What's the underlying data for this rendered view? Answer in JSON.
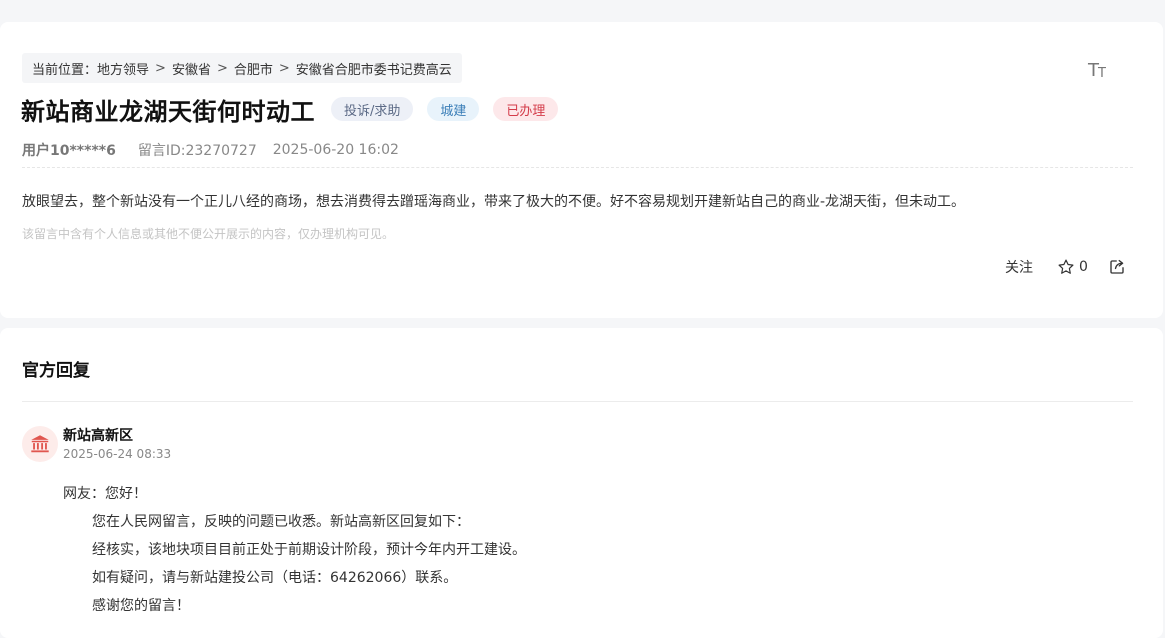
{
  "breadcrumb": {
    "prefix": "当前位置：",
    "items": [
      "地方领导",
      "安徽省",
      "合肥市",
      "安徽省合肥市委书记费高云"
    ],
    "separator": ">"
  },
  "font_size_toggle": {
    "big": "T",
    "small": "T"
  },
  "message": {
    "title": "新站商业龙湖天街何时动工",
    "tags": {
      "type": "投诉/求助",
      "category": "城建",
      "status": "已办理"
    },
    "user": "用户10*****6",
    "message_id": "留言ID:23270727",
    "datetime": "2025-06-20 16:02",
    "content": "放眼望去，整个新站没有一个正儿八经的商场，想去消费得去蹭瑶海商业，带来了极大的不便。好不容易规划开建新站自己的商业-龙湖天街，但未动工。",
    "privacy_note": "该留言中含有个人信息或其他不便公开展示的内容，仅办理机构可见。"
  },
  "actions": {
    "follow_label": "关注",
    "star_count": "0"
  },
  "reply": {
    "heading": "官方回复",
    "org_name": "新站高新区",
    "time": "2025-06-24 08:33",
    "greeting": "网友：您好！",
    "lines": [
      "您在人民网留言，反映的问题已收悉。新站高新区回复如下：",
      "经核实，该地块项目目前正处于前期设计阶段，预计今年内开工建设。",
      "如有疑问，请与新站建投公司（电话：64262066）联系。",
      "感谢您的留言！"
    ]
  },
  "colors": {
    "status_red": "#d43c4a",
    "category_blue": "#3b7fb8",
    "type_gray": "#5c6a86",
    "avatar_red": "#e0564f"
  }
}
